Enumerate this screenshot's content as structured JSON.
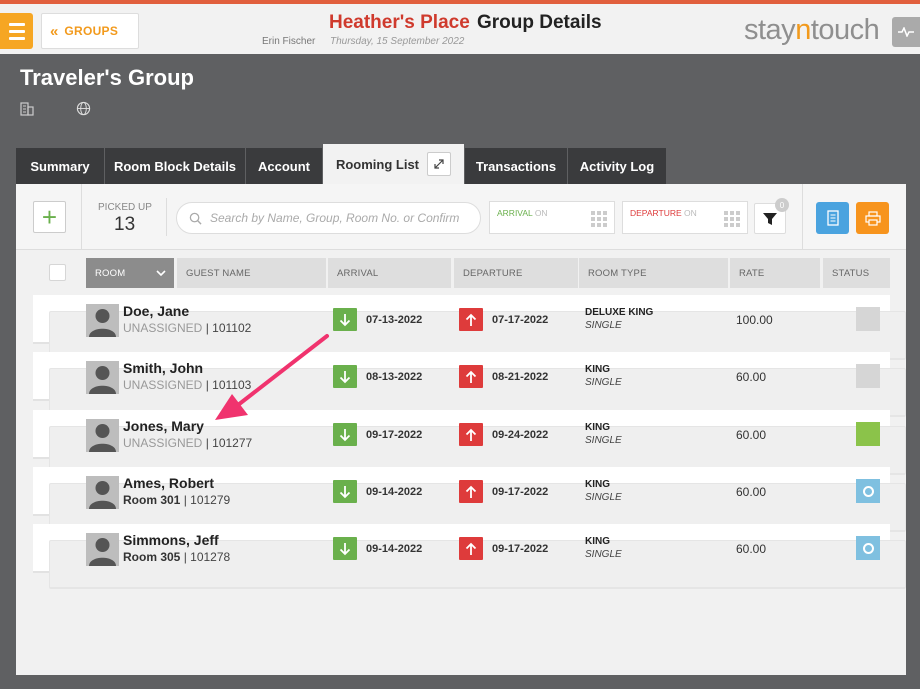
{
  "header": {
    "groups_label": "GROUPS",
    "hotel_name": "Heather's Place",
    "page_title": "Group Details",
    "user_name": "Erin Fischer",
    "business_date": "Thursday, 15 September 2022",
    "brand_prefix": "stay",
    "brand_n": "n",
    "brand_suffix": "touch"
  },
  "group": {
    "title": "Traveler's Group"
  },
  "tabs": [
    {
      "label": "Summary"
    },
    {
      "label": "Room Block Details"
    },
    {
      "label": "Account"
    },
    {
      "label": "Rooming List",
      "active": true
    },
    {
      "label": "Transactions"
    },
    {
      "label": "Activity Log"
    }
  ],
  "toolbar": {
    "picked_up_label": "PICKED UP",
    "picked_up_count": "13",
    "search_placeholder": "Search by Name, Group, Room No. or Confirm",
    "arrival_label": "ARRIVAL",
    "arrival_on": "ON",
    "departure_label": "DEPARTURE",
    "departure_on": "ON",
    "filter_count": "0"
  },
  "columns": {
    "room": "ROOM",
    "guest_name": "GUEST NAME",
    "arrival": "ARRIVAL",
    "departure": "DEPARTURE",
    "room_type": "ROOM TYPE",
    "rate": "RATE",
    "status": "STATUS"
  },
  "rows": [
    {
      "name": "Doe, Jane",
      "state": "UNASSIGNED",
      "confirm": "| 101102",
      "arrival": "07-13-2022",
      "departure": "07-17-2022",
      "room_type": "DELUXE KING",
      "occupancy": "SINGLE",
      "rate": "100.00",
      "status": "grey"
    },
    {
      "name": "Smith, John",
      "state": "UNASSIGNED",
      "confirm": "| 101103",
      "arrival": "08-13-2022",
      "departure": "08-21-2022",
      "room_type": "KING",
      "occupancy": "SINGLE",
      "rate": "60.00",
      "status": "grey"
    },
    {
      "name": "Jones, Mary",
      "state": "UNASSIGNED",
      "confirm": "| 101277",
      "arrival": "09-17-2022",
      "departure": "09-24-2022",
      "room_type": "KING",
      "occupancy": "SINGLE",
      "rate": "60.00",
      "status": "green"
    },
    {
      "name": "Ames, Robert",
      "state": "Room 301",
      "confirm": "| 101279",
      "arrival": "09-14-2022",
      "departure": "09-17-2022",
      "room_type": "KING",
      "occupancy": "SINGLE",
      "rate": "60.00",
      "status": "blue"
    },
    {
      "name": "Simmons, Jeff",
      "state": "Room 305",
      "confirm": "| 101278",
      "arrival": "09-14-2022",
      "departure": "09-17-2022",
      "room_type": "KING",
      "occupancy": "SINGLE",
      "rate": "60.00",
      "status": "blue"
    }
  ],
  "colors": {
    "accent": "#f29a1d",
    "hotel": "#cf3a2d",
    "arrival": "#6ab04c",
    "departure": "#de3b3b",
    "annotation_arrow": "#f0336e"
  }
}
